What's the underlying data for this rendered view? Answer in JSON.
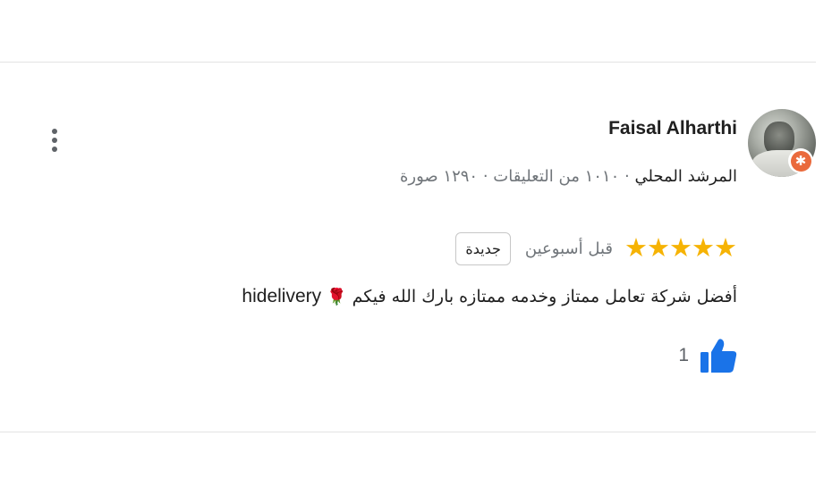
{
  "review": {
    "reviewer_name": "Faisal Alharthi",
    "reviewer_role": "المرشد المحلي",
    "reviewer_stats": "· ١٠١٠ من التعليقات · ١٢٩٠ صورة",
    "rating": 5,
    "rating_max": 5,
    "time_ago": "قبل أسبوعين",
    "new_badge": "جديدة",
    "text_arabic": "أفضل شركة تعامل ممتاز وخدمه ممتازه بارك الله فيكم",
    "text_emoji": "🌹",
    "text_english": "hidelivery",
    "like_count": "1",
    "colors": {
      "star": "#f6b304",
      "like": "#1a73e8",
      "guide_badge": "#ea6a3c"
    },
    "icons": {
      "more": "more-vert-icon",
      "like": "thumb-up-icon",
      "guide": "local-guide-star-icon"
    }
  }
}
